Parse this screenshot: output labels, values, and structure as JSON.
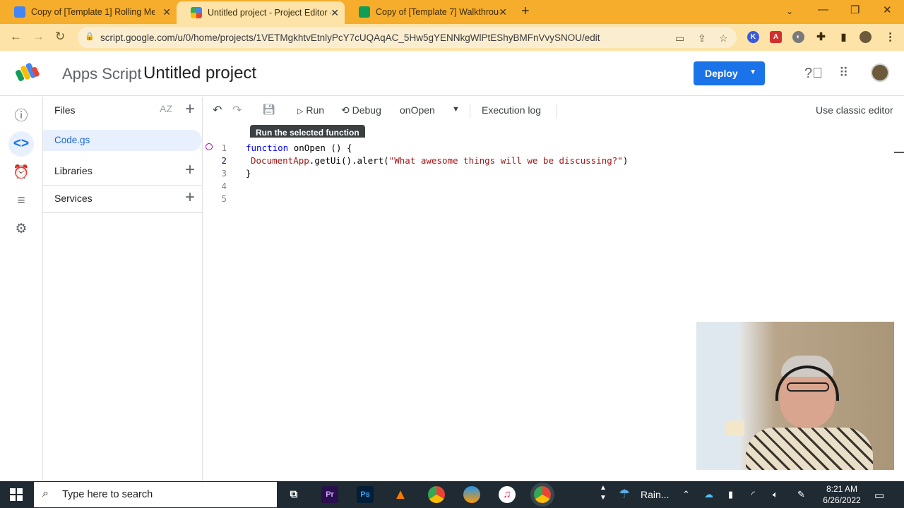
{
  "browser": {
    "tabs": [
      {
        "title": "Copy of [Template 1] Rolling Me",
        "color": "#4285f4"
      },
      {
        "title": "Untitled project - Project Editor -",
        "color": "#f4b400"
      },
      {
        "title": "Copy of [Template 7] Walkthroug",
        "color": "#0f9d58"
      }
    ],
    "url": "script.google.com/u/0/home/projects/1VETMgkhtvEtnlyPcY7cUQAqAC_5Hw5gYENNkgWlPtEShyBMFnVvySNOU/edit"
  },
  "header": {
    "app_name": "Apps Script",
    "project_title": "Untitled project",
    "deploy_label": "Deploy"
  },
  "files_panel": {
    "files_label": "Files",
    "sort_label": "AZ",
    "file_name": "Code.gs",
    "libraries_label": "Libraries",
    "services_label": "Services"
  },
  "toolbar": {
    "run_label": "Run",
    "debug_label": "Debug",
    "function_select": "onOpen",
    "execution_log_label": "Execution log",
    "classic_editor_label": "Use classic editor",
    "tooltip": "Run the selected function"
  },
  "editor": {
    "line_numbers": [
      "1",
      "2",
      "3",
      "4",
      "5"
    ],
    "code": {
      "l1_kw": "function",
      "l1_rest": " onOpen () {",
      "l2_cls": "DocumentApp",
      "l2_mid": ".getUi().alert(",
      "l2_str": "\"What awesome things will we be discussing?\"",
      "l2_end": ")",
      "l3": "}"
    }
  },
  "taskbar": {
    "search_placeholder": "Type here to search",
    "weather": "Rain...",
    "time": "8:21 AM",
    "date": "6/26/2022",
    "apps": [
      "Pr",
      "Ps"
    ]
  }
}
